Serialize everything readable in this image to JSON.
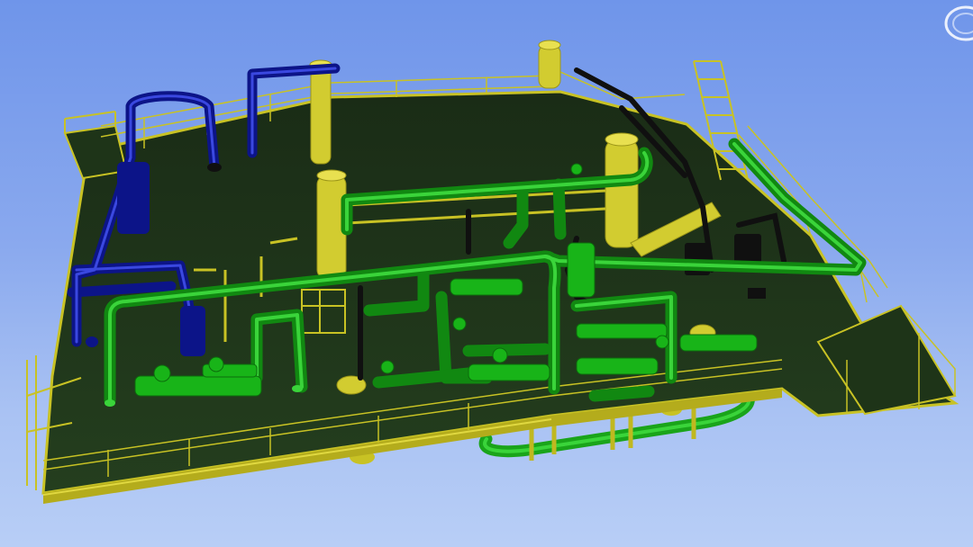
{
  "viewport": {
    "background_top": "#6f95ea",
    "background_bottom": "#b8cef6"
  },
  "model": {
    "deck_color": "#1e3418",
    "structure_color": "#c8c224",
    "process_pipe_color": "#18b418",
    "utility_pipe_color": "#1018b0",
    "instrument_line_color": "#101010",
    "equipment_color": "#d2cc30"
  },
  "controls": {
    "nav_cube_icon": "orbit-ring-icon"
  }
}
